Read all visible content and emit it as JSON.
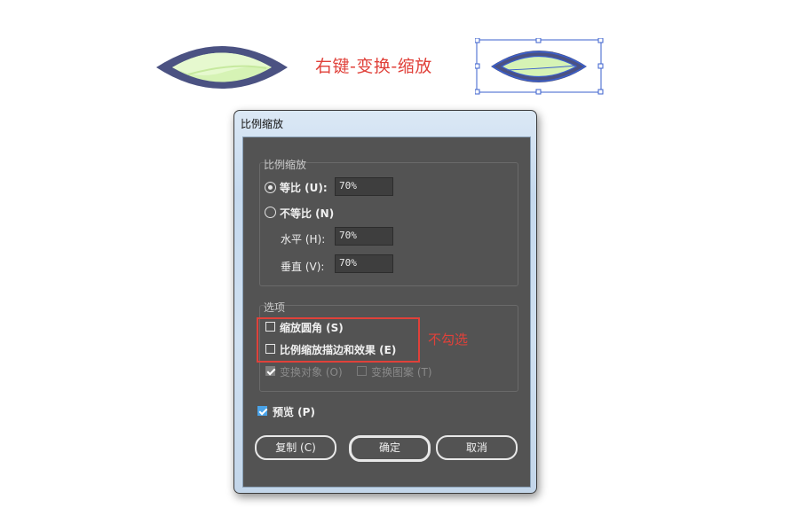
{
  "illustration": {
    "instruction": "右键-变换-缩放",
    "note": "不勾选"
  },
  "dialog": {
    "title": "比例缩放",
    "scale_group": {
      "label": "比例缩放",
      "uniform": {
        "label": "等比 (U):",
        "value": "70%",
        "selected": true
      },
      "non_uniform": {
        "label": "不等比 (N)",
        "selected": false
      },
      "horizontal": {
        "label": "水平 (H):",
        "value": "70%"
      },
      "vertical": {
        "label": "垂直 (V):",
        "value": "70%"
      }
    },
    "options_group": {
      "label": "选项",
      "scale_corners": {
        "label": "缩放圆角 (S)",
        "checked": false
      },
      "scale_strokes": {
        "label": "比例缩放描边和效果 (E)",
        "checked": false
      },
      "transform_objects": {
        "label": "变换对象 (O)",
        "checked": true,
        "enabled": false
      },
      "transform_patterns": {
        "label": "变换图案 (T)",
        "checked": false,
        "enabled": false
      }
    },
    "preview": {
      "label": "预览 (P)",
      "checked": true
    },
    "buttons": {
      "copy": "复制 (C)",
      "ok": "确定",
      "cancel": "取消"
    }
  },
  "colors": {
    "annotation_red": "#e0413a",
    "leaf_outline": "#4b5282",
    "leaf_fill": "#d6f3b5",
    "selection_blue": "#3a5fcd",
    "dialog_body": "#535353"
  }
}
